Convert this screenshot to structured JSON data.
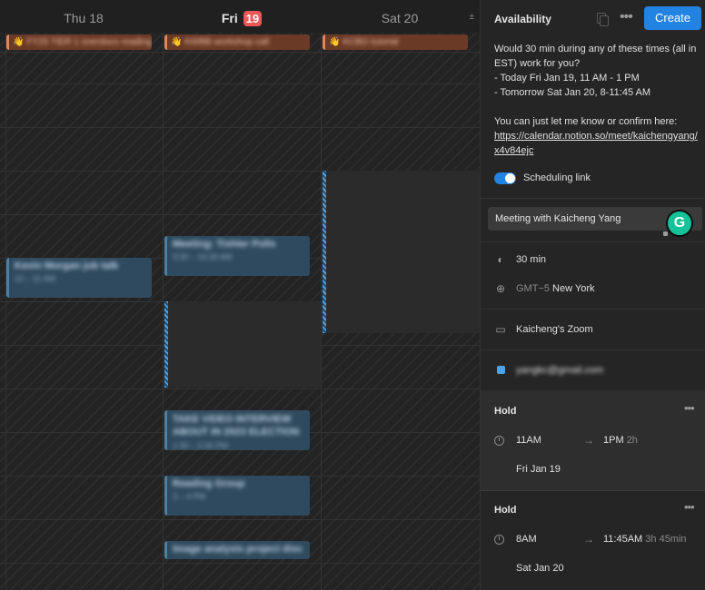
{
  "calendar": {
    "days": [
      {
        "label": "Thu 18"
      },
      {
        "label": "Fri",
        "badge": "19"
      },
      {
        "label": "Sat 20"
      }
    ],
    "scroll_icon": "±",
    "allday_events": [
      {
        "emoji": "👋",
        "title": "FY25 TIER 1 onerdocs reading"
      },
      {
        "emoji": "👋",
        "title": "KWBB workshop call"
      },
      {
        "emoji": "👋",
        "title": "KCBO tutorial"
      }
    ],
    "events": [
      {
        "title": "Kevin Morgan job talk",
        "time": "10 – 11 AM"
      },
      {
        "title": "Meeting: Tishler Polls",
        "time": "9:30 – 10:30 AM"
      },
      {
        "title": "TAKE VIDEO INTERVIEW ABOUT IN 2023 ELECTION",
        "time": "1:30 – 2:30 PM"
      },
      {
        "title": "Reading Group",
        "time": "3 – 4 PM"
      },
      {
        "title": "Image analysis project disc",
        "time": ""
      }
    ]
  },
  "panel": {
    "title": "Availability",
    "icons": {
      "copy": "copy-icon",
      "more": "more-icon"
    },
    "create_label": "Create",
    "message": {
      "line1": "Would 30 min during any of these times (all in EST) work for you?",
      "line2": "- Today Fri Jan 19, 11 AM - 1 PM",
      "line3": "- Tomorrow Sat Jan 20, 8-11:45 AM",
      "line4": "You can just let me know or confirm here:",
      "link": "https://calendar.notion.so/meet/kaichengyang/x4v84ejc"
    },
    "scheduling_link_label": "Scheduling link",
    "scheduling_link_on": true,
    "meeting_title": "Meeting with Kaicheng Yang",
    "duration": "30 min",
    "timezone_offset": "GMT−5",
    "timezone_city": "New York",
    "conference": "Kaicheng's Zoom",
    "calendar_email": "yangkc@gmail.com",
    "holds": [
      {
        "label": "Hold",
        "start": "11AM",
        "end": "1PM",
        "length": "2h",
        "date": "Fri Jan 19"
      },
      {
        "label": "Hold",
        "start": "8AM",
        "end": "11:45AM",
        "length": "3h 45min",
        "date": "Sat Jan 20"
      }
    ],
    "accent_color": "#2383e2",
    "grammarly_letter": "G"
  }
}
